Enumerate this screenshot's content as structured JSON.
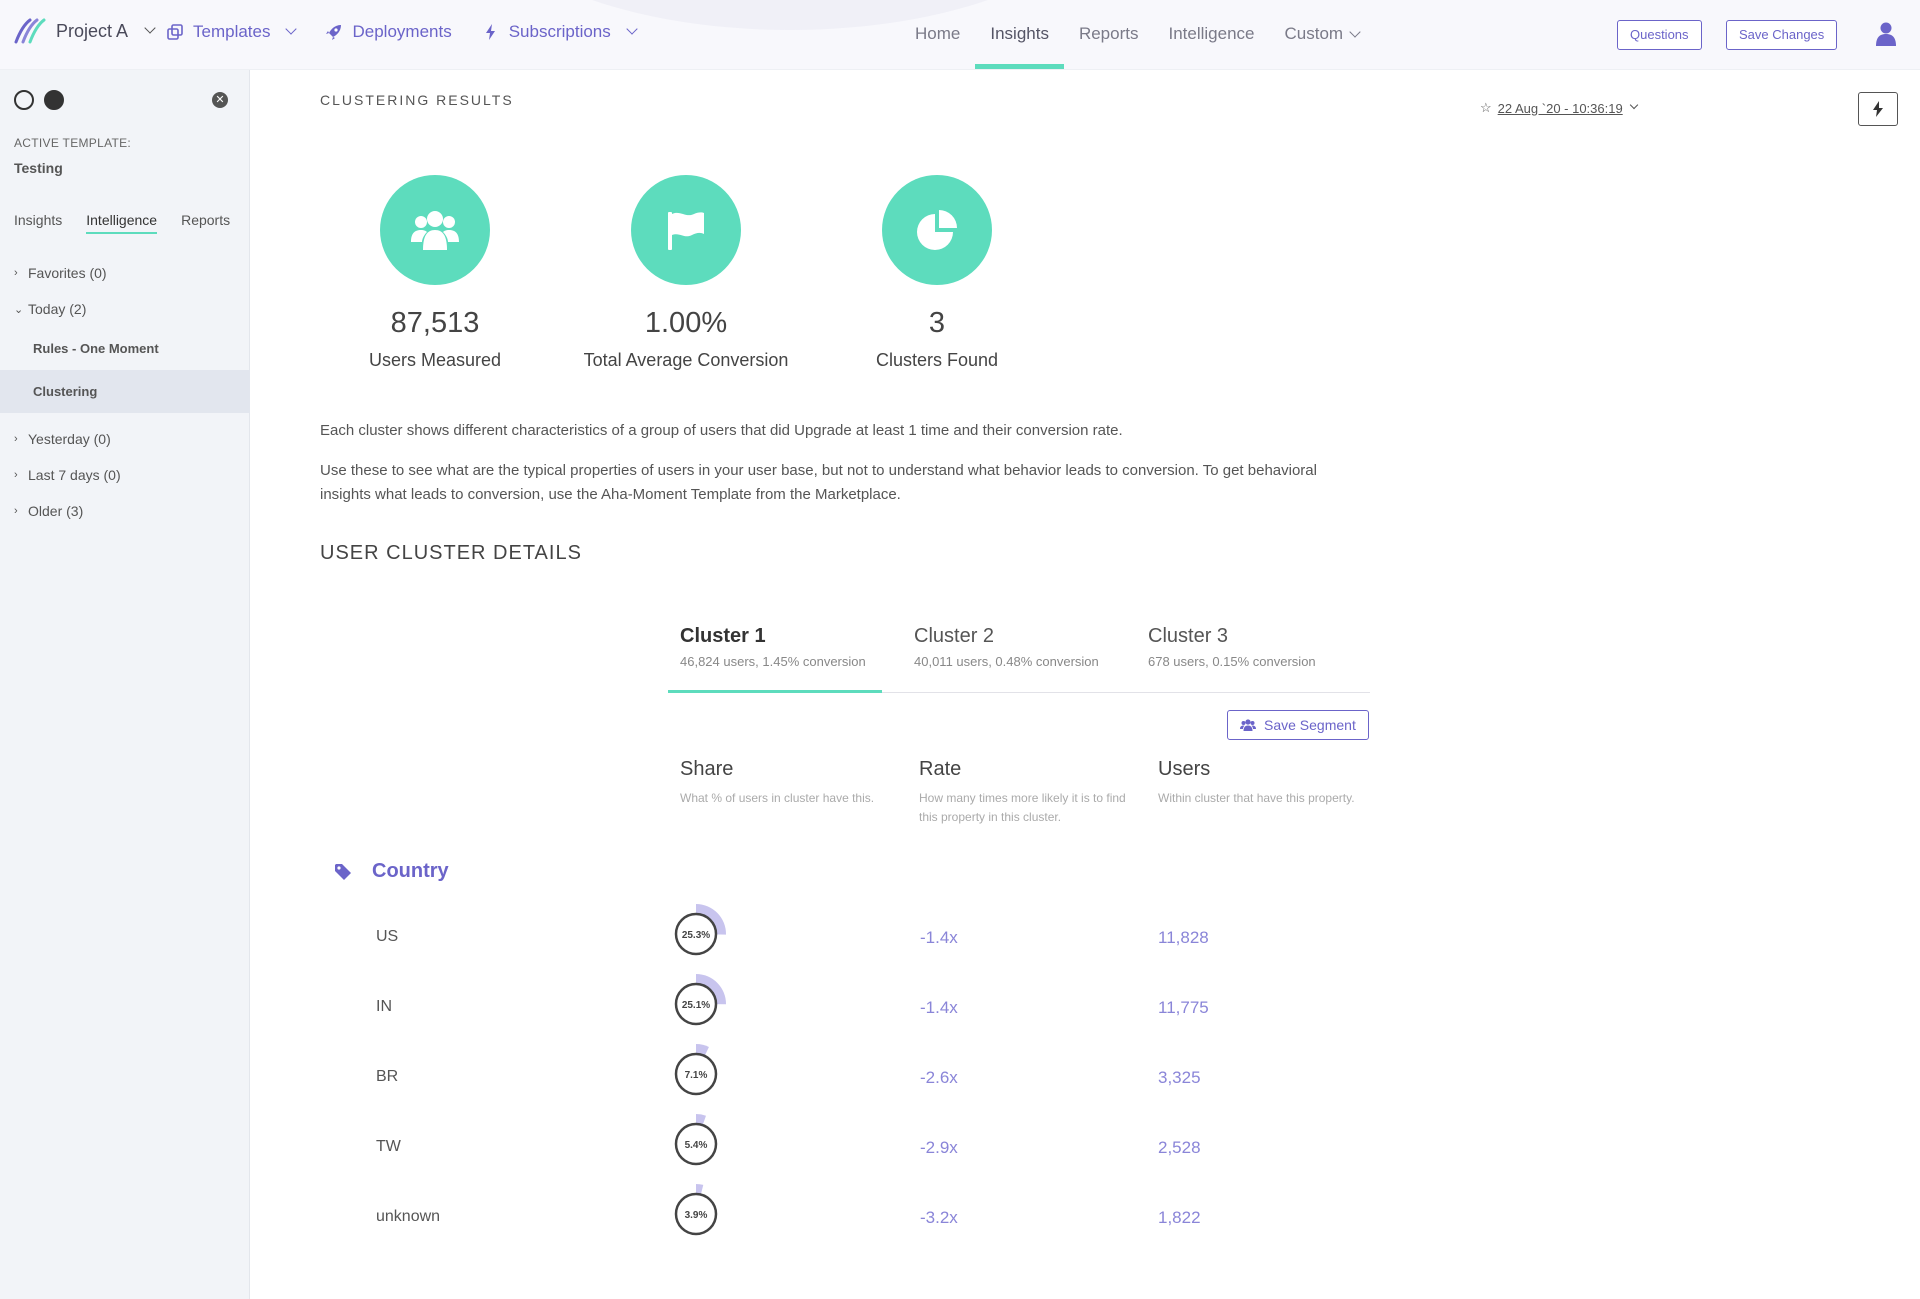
{
  "colors": {
    "accent": "#5ddcbd",
    "brand": "#6b64c9",
    "value": "#8a85d8",
    "share_fill": "#c8c4ee"
  },
  "header": {
    "project": "Project A",
    "left_nav": [
      {
        "label": "Templates",
        "icon": "templates-icon"
      },
      {
        "label": "Deployments",
        "icon": "rocket-icon"
      },
      {
        "label": "Subscriptions",
        "icon": "bolt-icon"
      }
    ],
    "center_nav": [
      "Home",
      "Insights",
      "Reports",
      "Intelligence",
      "Custom"
    ],
    "active_tab": "Insights",
    "questions_label": "Questions",
    "save_changes_label": "Save Changes"
  },
  "sidebar": {
    "active_template_label": "ACTIVE TEMPLATE:",
    "active_template_value": "Testing",
    "tabs": [
      "Insights",
      "Intelligence",
      "Reports"
    ],
    "active_tab": "Intelligence",
    "groups": [
      {
        "label": "Favorites (0)",
        "expanded": false
      },
      {
        "label": "Today (2)",
        "expanded": true,
        "children": [
          "Rules - One Moment",
          "Clustering"
        ]
      },
      {
        "label": "Yesterday (0)",
        "expanded": false
      },
      {
        "label": "Last 7 days (0)",
        "expanded": false
      },
      {
        "label": "Older (3)",
        "expanded": false
      }
    ],
    "selected_child": "Clustering"
  },
  "main": {
    "title": "CLUSTERING RESULTS",
    "timestamp": "22 Aug `20 - 10:36:19",
    "stats": [
      {
        "value": "87,513",
        "label": "Users Measured",
        "icon": "users-icon"
      },
      {
        "value": "1.00%",
        "label": "Total Average Conversion",
        "icon": "flag-icon"
      },
      {
        "value": "3",
        "label": "Clusters Found",
        "icon": "pie-chart-icon"
      }
    ],
    "description_1": "Each cluster shows different characteristics of a group of users that did Upgrade at least 1 time and their conversion rate.",
    "description_2": "Use these to see what are the typical properties of users in your user base, but not to understand what behavior leads to conversion. To get behavioral insights what leads to conversion, use the Aha-Moment Template from the Marketplace.",
    "details_title": "USER CLUSTER DETAILS",
    "clusters": [
      {
        "name": "Cluster 1",
        "summary": "46,824 users, 1.45% conversion"
      },
      {
        "name": "Cluster 2",
        "summary": "40,011 users, 0.48% conversion"
      },
      {
        "name": "Cluster 3",
        "summary": "678 users, 0.15% conversion"
      }
    ],
    "active_cluster": "Cluster 1",
    "save_segment_label": "Save Segment",
    "columns": [
      {
        "title": "Share",
        "desc": "What % of users in cluster have this."
      },
      {
        "title": "Rate",
        "desc": "How many times more likely it is to find this property in this cluster."
      },
      {
        "title": "Users",
        "desc": "Within cluster that have this property."
      }
    ],
    "category": "Country",
    "rows": [
      {
        "name": "US",
        "share": 25.3,
        "share_label": "25.3%",
        "rate": "-1.4x",
        "users": "11,828"
      },
      {
        "name": "IN",
        "share": 25.1,
        "share_label": "25.1%",
        "rate": "-1.4x",
        "users": "11,775"
      },
      {
        "name": "BR",
        "share": 7.1,
        "share_label": "7.1%",
        "rate": "-2.6x",
        "users": "3,325"
      },
      {
        "name": "TW",
        "share": 5.4,
        "share_label": "5.4%",
        "rate": "-2.9x",
        "users": "2,528"
      },
      {
        "name": "unknown",
        "share": 3.9,
        "share_label": "3.9%",
        "rate": "-3.2x",
        "users": "1,822"
      }
    ]
  }
}
